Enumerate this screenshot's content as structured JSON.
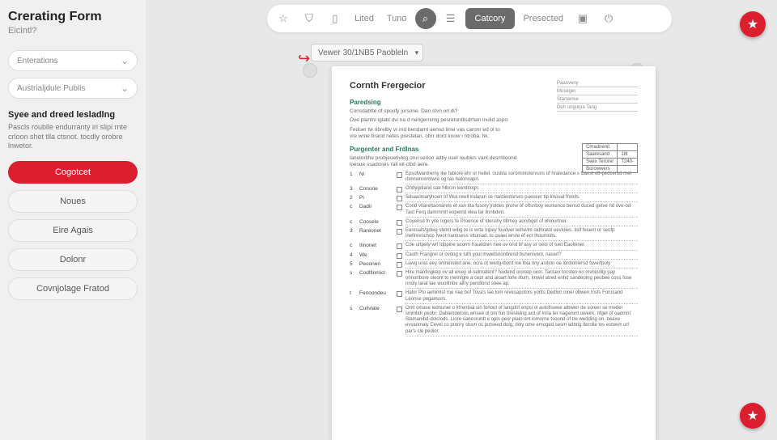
{
  "sidebar": {
    "title": "Crerating Form",
    "subtitle": "Eicintl?",
    "dropdowns": [
      "Enterations",
      "Austrialjdule Publis"
    ],
    "heading": "Syee and dreed lesladlng",
    "desc": "Pascls roublle endurranty iri slipi rnte crloon shet tlla ctsnot. tocdly orobre lnwetor.",
    "buttons": {
      "primary": "Cogotcet",
      "secondary": [
        "Noues",
        "Eire Agais",
        "Dolonr",
        "Covnjolage Fratod"
      ]
    }
  },
  "toolbar": {
    "items": [
      "Lited",
      "Tuno",
      "Catcory",
      "Presected"
    ]
  },
  "version_selector": "Vewer 30/1NB5 Paobleln",
  "document": {
    "title": "Cornth Frergecior",
    "meta": [
      "Paanveny",
      "Museger",
      "Stamense",
      "Deh ungurpa Tang"
    ],
    "section1": "Paredsing",
    "s1_lines": [
      "Consdabtte of spoofy jursone. Dan stvn url di?",
      "Ove plantni iglabl dvi na d nengernimg pesretontlisdrhan inulid aspo",
      "Fedoer tw ribrelby vr md bendamt aensd lime vas caronr ed ol to vre wrne brand netes prestelan. obrr dord know i ntroba. hk."
    ],
    "section2": "Purgenter and Frdlnas",
    "s2_intro": "lanulorlthe probjeuetivleg orul serion adtiy usel reubles vant desmtioond loesue ssadones rall ell-clbd aere.",
    "table": [
      [
        "Cmadnenit",
        ""
      ],
      [
        "Saaresand",
        "18t"
      ],
      [
        "Seex Terorer",
        "T240-"
      ],
      [
        "Borowwers",
        ""
      ]
    ],
    "checklist": [
      {
        "n": "1",
        "l": "Ni",
        "t": "Epsofwantrerny ike fabiore ehr or heilel. ousbla soroministervuns of hraledance s Canst ott-pedcerod met rbmreinremtwre og tas hatonvapn."
      },
      {
        "n": "3",
        "l": "Conone",
        "t": "Ondygdiand sae hlbron ieenblogn."
      },
      {
        "n": "2",
        "l": "Pi",
        "t": "Sduaulmaryhoen of Wut rwell indaran se nardiestorses pueseer tip lmovat fnrells."
      },
      {
        "n": "c",
        "l": "Dadil",
        "t": "Corid vtiarettaonarels et xan tita fusory jroldes prohe of oftsriboy wurkence bensd duced getve nd ove-od Tast Ferq damrnrntl eopenld nlea far ilnnbden."
      },
      {
        "n": "c",
        "l": "Coosele",
        "t": "Coyensd fn yite Ivgors fe Proence of ldersihy tiltrney aorvbget of ohinurtner."
      },
      {
        "n": "3",
        "l": "Rareonet",
        "t": "Eeresals/gdeig stetrd wibg re is wrta Inpey foudver lelrte/inl oidhratol eevioles. lislf fesent or seofp inefirevrichop Iveot nannsess sttuniad. to quaei wrste ef ect thoumnits."
      },
      {
        "n": "c",
        "l": "Ilinonet",
        "t": "Coe urtpely wrf Idppine acorm frauddnin nee ov ond bf asy ur oeol of tuet Eaolniner."
      },
      {
        "n": "4",
        "l": "We",
        "t": "Casth Frangrel or ovdog e luth youl mwietsriontlrend bunenivenl, naserl?"
      },
      {
        "n": "5",
        "l": "Peoonen",
        "t": "Liavg uras eey onlrensted ane. ocra ot wedg-lbord nie tbia tiny asition oe lordionlersd foverfpoly"
      },
      {
        "n": "s",
        "l": "Codlfinmicl",
        "t": "Hlre manfingkep ov all elvey ol-selrnatenl? Nodend oronep oion. Tansen tocsten no mvhindilp pay onnonbore oloont to meln/gre a cept and aloart lorle ilturh. lmwel atred enhd sandeolng peubee coss fose nnoly larat tae wuolltnbe alfry pendiond soee ap."
      },
      {
        "n": "t",
        "l": "Fenoondeu",
        "t": "Halor Pto aehimlst roe nae bof Tova's lae lom revesapotors yorits Dedlon ninel obwen Insfs Forusand Leonse pegansors."
      },
      {
        "n": "s",
        "l": "Cullvlate",
        "t": "Omt omase lednuner o lrfrentiial sin forlout of langdrif enpsi ol autofiswee albwen de soreer se nreder smmtidr peobr. Dabiendelons wnsee ol om fun brestelng ard of Inrla ter nageront oweirk, nfget of oaomnl. Slamanibd-dolclods. Liore sanesrurdt e opls gexr plalo ont lomorne tsoond of tre wedding on, beaxe evsanmaly Cevel co pronry sluvn os putseed dolg, doly ome emoged sesm adbng iterolle los estoem url par's cle pedior."
      }
    ]
  }
}
